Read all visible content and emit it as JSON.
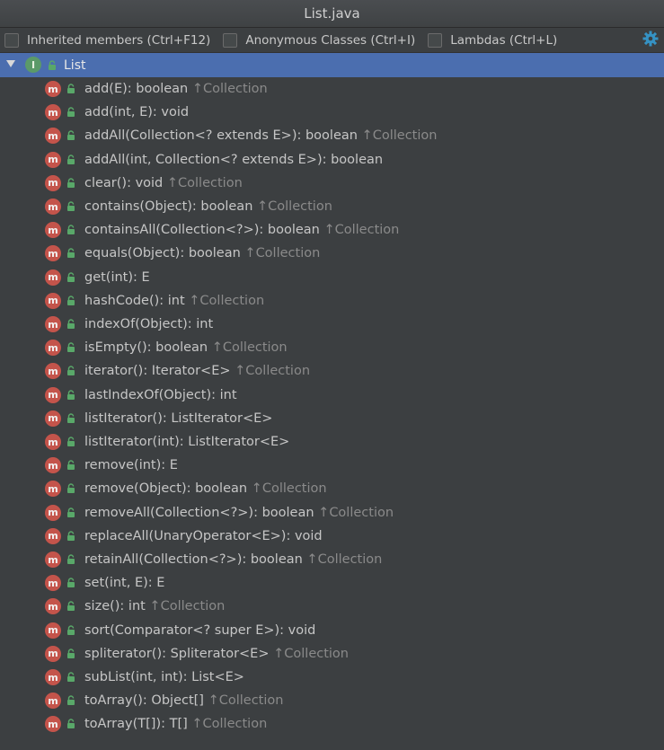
{
  "window": {
    "title": "List.java"
  },
  "toolbar": {
    "inherited": "Inherited members (Ctrl+F12)",
    "anonymous": "Anonymous Classes (Ctrl+I)",
    "lambdas": "Lambdas (Ctrl+L)"
  },
  "tree": {
    "root": {
      "label": "List",
      "icon": "interface-icon"
    },
    "items": [
      {
        "sig": "add(E): boolean",
        "inherit": "Collection",
        "icon": "method-icon"
      },
      {
        "sig": "add(int, E): void",
        "inherit": "",
        "icon": "method-icon"
      },
      {
        "sig": "addAll(Collection<? extends E>): boolean",
        "inherit": "Collection",
        "icon": "method-icon"
      },
      {
        "sig": "addAll(int, Collection<? extends E>): boolean",
        "inherit": "",
        "icon": "method-icon"
      },
      {
        "sig": "clear(): void",
        "inherit": "Collection",
        "icon": "method-icon"
      },
      {
        "sig": "contains(Object): boolean",
        "inherit": "Collection",
        "icon": "method-icon"
      },
      {
        "sig": "containsAll(Collection<?>): boolean",
        "inherit": "Collection",
        "icon": "method-icon"
      },
      {
        "sig": "equals(Object): boolean",
        "inherit": "Collection",
        "icon": "method-icon"
      },
      {
        "sig": "get(int): E",
        "inherit": "",
        "icon": "method-icon"
      },
      {
        "sig": "hashCode(): int",
        "inherit": "Collection",
        "icon": "method-icon"
      },
      {
        "sig": "indexOf(Object): int",
        "inherit": "",
        "icon": "method-icon"
      },
      {
        "sig": "isEmpty(): boolean",
        "inherit": "Collection",
        "icon": "method-icon"
      },
      {
        "sig": "iterator(): Iterator<E>",
        "inherit": "Collection",
        "icon": "method-icon"
      },
      {
        "sig": "lastIndexOf(Object): int",
        "inherit": "",
        "icon": "method-icon"
      },
      {
        "sig": "listIterator(): ListIterator<E>",
        "inherit": "",
        "icon": "method-icon"
      },
      {
        "sig": "listIterator(int): ListIterator<E>",
        "inherit": "",
        "icon": "method-icon"
      },
      {
        "sig": "remove(int): E",
        "inherit": "",
        "icon": "method-icon"
      },
      {
        "sig": "remove(Object): boolean",
        "inherit": "Collection",
        "icon": "method-icon"
      },
      {
        "sig": "removeAll(Collection<?>): boolean",
        "inherit": "Collection",
        "icon": "method-icon"
      },
      {
        "sig": "replaceAll(UnaryOperator<E>): void",
        "inherit": "",
        "icon": "method-icon"
      },
      {
        "sig": "retainAll(Collection<?>): boolean",
        "inherit": "Collection",
        "icon": "method-icon"
      },
      {
        "sig": "set(int, E): E",
        "inherit": "",
        "icon": "method-icon"
      },
      {
        "sig": "size(): int",
        "inherit": "Collection",
        "icon": "method-icon"
      },
      {
        "sig": "sort(Comparator<? super E>): void",
        "inherit": "",
        "icon": "method-icon"
      },
      {
        "sig": "spliterator(): Spliterator<E>",
        "inherit": "Collection",
        "icon": "method-icon"
      },
      {
        "sig": "subList(int, int): List<E>",
        "inherit": "",
        "icon": "method-icon"
      },
      {
        "sig": "toArray(): Object[]",
        "inherit": "Collection",
        "icon": "method-icon"
      },
      {
        "sig": "toArray(T[]): T[]",
        "inherit": "Collection",
        "icon": "method-icon"
      }
    ]
  },
  "colors": {
    "background": "#3c3f41",
    "selection": "#4b6eaf",
    "method_icon": "#c4544b",
    "interface_icon": "#5b9a68",
    "gear": "#3592c4"
  }
}
